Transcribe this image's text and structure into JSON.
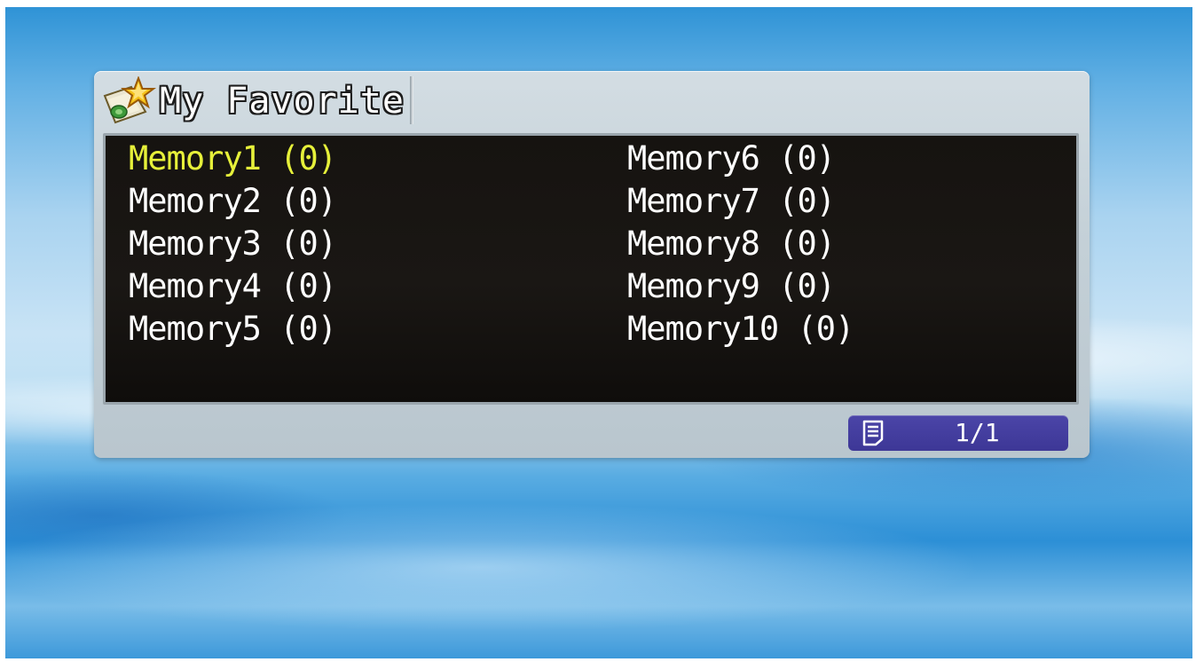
{
  "window": {
    "title": "My Favorite",
    "icon": "favorites-star-folder-icon"
  },
  "memory_list": {
    "selected_index": 0,
    "items": [
      "Memory1 (0)",
      "Memory2 (0)",
      "Memory3 (0)",
      "Memory4 (0)",
      "Memory5 (0)",
      "Memory6 (0)",
      "Memory7 (0)",
      "Memory8 (0)",
      "Memory9 (0)",
      "Memory10 (0)"
    ]
  },
  "pagination": {
    "icon": "page-list-icon",
    "text": "1/1"
  },
  "colors": {
    "selected_text": "#e6f03a",
    "normal_text": "#ffffff",
    "list_background": "#161310",
    "page_indicator": "#423c9e",
    "panel": "#c5d1d8"
  }
}
